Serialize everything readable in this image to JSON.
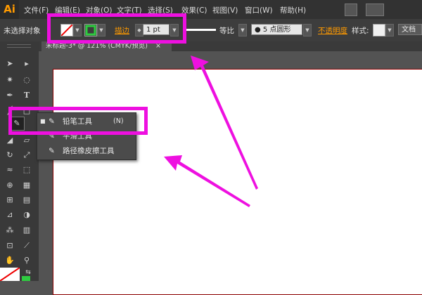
{
  "app": {
    "logo": "Ai"
  },
  "menu": [
    "文件(F)",
    "编辑(E)",
    "对象(O)",
    "文字(T)",
    "选择(S)",
    "效果(C)",
    "视图(V)",
    "窗口(W)",
    "帮助(H)"
  ],
  "control": {
    "selection_status": "未选择对象",
    "stroke_label": "描边",
    "stroke_weight": "1 pt",
    "profile": "等比",
    "brush": "5 点圆形",
    "opacity_label": "不透明度",
    "style_label": "样式:",
    "document_label": "文档"
  },
  "doc_tab": {
    "title": "未标题-3* @ 121% (CMYK/预览)",
    "close": "×"
  },
  "flyout": {
    "items": [
      {
        "label": "铅笔工具",
        "shortcut": "(N)",
        "selected": true
      },
      {
        "label": "平滑工具"
      },
      {
        "label": "路径橡皮擦工具"
      }
    ]
  },
  "colors": {
    "highlight": "#ee10e0",
    "accent": "#ff9a00",
    "artboard_border": "#8b0000"
  },
  "icons": [
    "selection-icon",
    "direct-selection-icon",
    "magic-wand-icon",
    "lasso-icon",
    "pen-icon",
    "type-icon",
    "line-icon",
    "rectangle-icon",
    "pencil-icon",
    "eraser-icon",
    "rotate-icon",
    "scale-icon",
    "warp-icon",
    "free-transform-icon",
    "symbol-sprayer-icon",
    "graph-icon",
    "mesh-icon",
    "gradient-icon",
    "eyedropper-icon",
    "blend-icon",
    "slice-icon",
    "artboard-icon",
    "hand-icon",
    "zoom-icon"
  ]
}
